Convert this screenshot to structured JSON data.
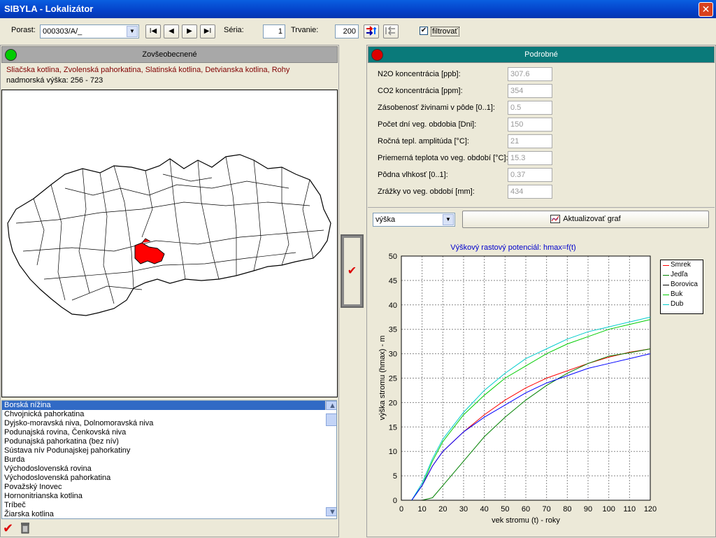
{
  "window": {
    "title": "SIBYLA - Lokalizátor"
  },
  "toolbar": {
    "porast_label": "Porast:",
    "porast_value": "000303/A/_",
    "nav_first": "I◀",
    "nav_prev": "◀",
    "nav_next": "▶",
    "nav_last": "▶I",
    "seria_label": "Séria:",
    "seria_value": "1",
    "trvanie_label": "Trvanie:",
    "trvanie_value": "200",
    "filter_label": "filtrovať",
    "filter_checked": true
  },
  "left_panel": {
    "header": "Zovšeobecnené",
    "status_color": "#00cc00",
    "regions_text": "Sliačska kotlina, Zvolenská pahorkatina, Slatinská kotlina, Detvianska kotlina, Rohy",
    "altitude_text": "nadmorská výška: 256 - 723"
  },
  "region_list": {
    "items": [
      "Borská nížina",
      "Chvojnická pahorkatina",
      "Dyjsko-moravská niva, Dolnomoravská niva",
      "Podunajská rovina, Čenkovská niva",
      "Podunajská pahorkatina (bez nív)",
      "Sústava nív Podunajskej pahorkatiny",
      "Burda",
      "Východoslovenská rovina",
      "Východoslovenská pahorkatina",
      "Považský Inovec",
      "Hornonitrianska kotlina",
      "Tríbeč",
      "Žiarska kotlina"
    ],
    "selected_index": 0
  },
  "right_panel": {
    "header": "Podrobné",
    "status_color": "#dd0000",
    "fields": [
      {
        "label": "N2O koncentrácia [ppb]:",
        "value": "307.6"
      },
      {
        "label": "CO2 koncentrácia [ppm]:",
        "value": "354"
      },
      {
        "label": "Zásobenosť živinami v pôde [0..1]:",
        "value": "0.5"
      },
      {
        "label": "Počet dní veg. obdobia [Dni]:",
        "value": "150"
      },
      {
        "label": "Ročná tepl. amplitúda [°C]:",
        "value": "21"
      },
      {
        "label": "Priemerná teplota vo veg. období [°C]:",
        "value": "15.3"
      },
      {
        "label": "Pôdna vlhkosť [0..1]:",
        "value": "0.37"
      },
      {
        "label": "Zrážky vo veg. období [mm]:",
        "value": "434"
      }
    ],
    "graph_select": "výška",
    "update_button": "Aktualizovať graf"
  },
  "chart_data": {
    "type": "line",
    "title": "Výškový rastový potenciál: hmax=f(t)",
    "xlabel": "vek stromu (t) - roky",
    "ylabel": "výška stromu (hmax) - m",
    "xlim": [
      0,
      120
    ],
    "ylim": [
      0,
      50
    ],
    "xticks": [
      0,
      10,
      20,
      30,
      40,
      50,
      60,
      70,
      80,
      90,
      100,
      110,
      120
    ],
    "yticks": [
      0,
      5,
      10,
      15,
      20,
      25,
      30,
      35,
      40,
      45,
      50
    ],
    "grid": true,
    "legend_position": "top-right",
    "x": [
      5,
      10,
      15,
      20,
      30,
      40,
      50,
      60,
      70,
      80,
      90,
      100,
      110,
      120
    ],
    "series": [
      {
        "name": "Smrek",
        "color": "#ff0000",
        "values": [
          0,
          3,
          7,
          10,
          14,
          17.5,
          20.5,
          23,
          25,
          26.5,
          28,
          29.3,
          30.3,
          31
        ]
      },
      {
        "name": "Jedľa",
        "color": "#008000",
        "values": [
          0,
          0,
          0.5,
          3,
          8,
          13,
          17,
          20.5,
          23.5,
          26,
          28,
          29.5,
          30.2,
          31
        ]
      },
      {
        "name": "Borovica",
        "color": "#000000",
        "values": [
          0,
          0,
          0,
          0,
          0,
          0,
          0,
          0,
          0,
          0,
          0,
          0,
          0,
          0
        ]
      },
      {
        "name": "Buk",
        "color": "#00cc00",
        "values": [
          0,
          3,
          8,
          12,
          17.5,
          21.5,
          25,
          27.5,
          30,
          32,
          33.5,
          35,
          36,
          37
        ]
      },
      {
        "name": "Dub",
        "color": "#00cccc",
        "values": [
          0,
          3.5,
          8.5,
          12.5,
          18,
          22.5,
          26,
          29,
          31,
          33,
          34.5,
          35.5,
          36.5,
          37.5
        ]
      },
      {
        "name": "",
        "color": "#0000ff",
        "values": [
          0,
          3,
          7,
          10,
          14,
          17,
          19.5,
          22,
          24,
          25.5,
          27,
          28,
          29,
          30
        ]
      }
    ]
  }
}
